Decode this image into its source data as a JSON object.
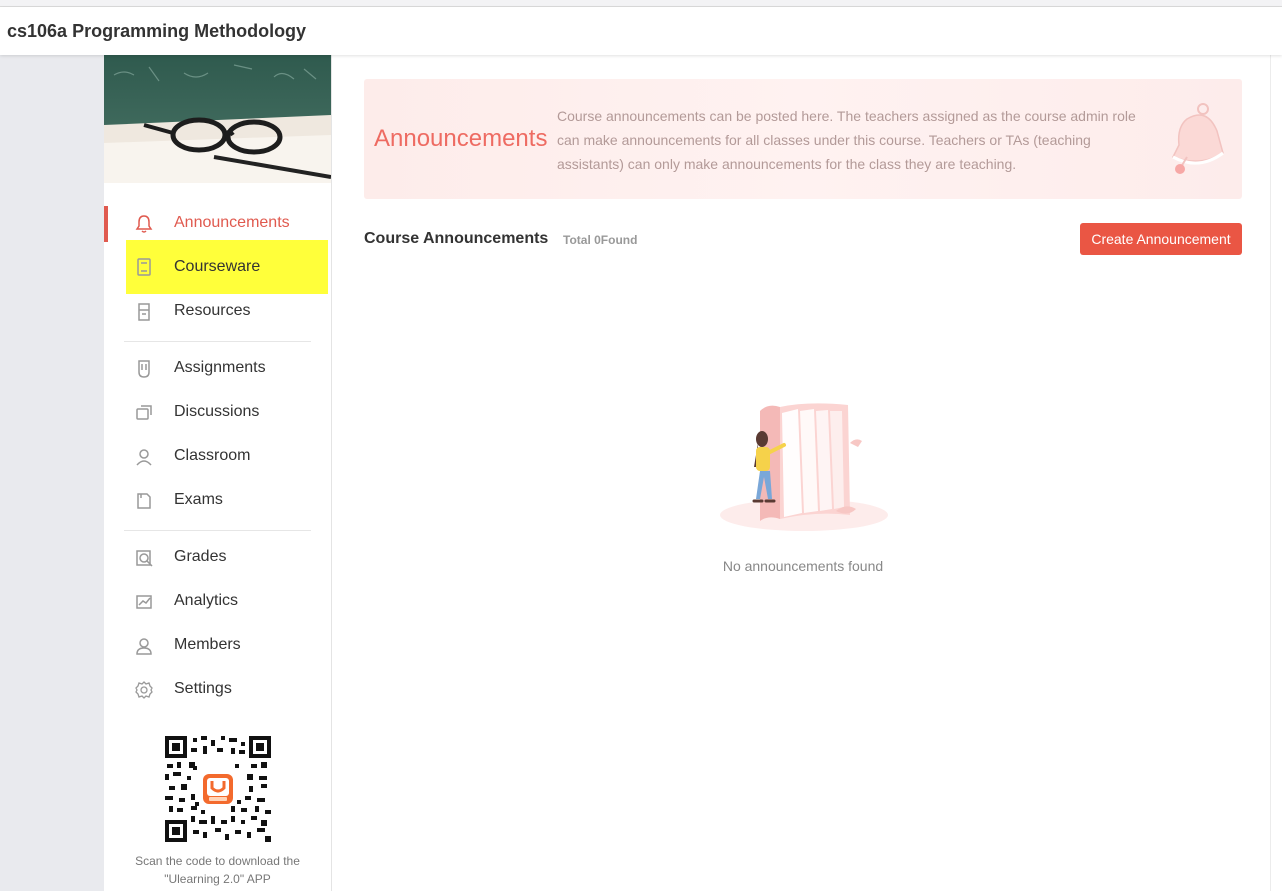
{
  "header": {
    "course_title": "cs106a Programming Methodology"
  },
  "sidebar": {
    "items": [
      {
        "label": "Announcements",
        "icon": "bell-icon"
      },
      {
        "label": "Courseware",
        "icon": "book-icon"
      },
      {
        "label": "Resources",
        "icon": "resources-icon"
      },
      {
        "label": "Assignments",
        "icon": "assignment-icon"
      },
      {
        "label": "Discussions",
        "icon": "discussion-icon"
      },
      {
        "label": "Classroom",
        "icon": "classroom-icon"
      },
      {
        "label": "Exams",
        "icon": "exam-icon"
      },
      {
        "label": "Grades",
        "icon": "grades-icon"
      },
      {
        "label": "Analytics",
        "icon": "analytics-icon"
      },
      {
        "label": "Members",
        "icon": "members-icon"
      },
      {
        "label": "Settings",
        "icon": "settings-icon"
      }
    ],
    "active_item": "Announcements",
    "highlighted_item": "Courseware",
    "qr_caption_line1": "Scan the code to download the",
    "qr_caption_line2": "\"Ulearning 2.0\" APP"
  },
  "intro": {
    "title": "Announcements",
    "description": "Course announcements can be posted here. The teachers assigned as the course admin role can make announcements for all classes under this course. Teachers or TAs (teaching assistants) can only make announcements for the class they are teaching."
  },
  "section": {
    "title": "Course Announcements",
    "count_text": "Total 0Found",
    "create_button": "Create Announcement"
  },
  "empty_state": {
    "text": "No announcements found"
  },
  "colors": {
    "accent": "#ea5644",
    "highlight": "#ffff3a",
    "intro_title": "#ee6b62"
  }
}
